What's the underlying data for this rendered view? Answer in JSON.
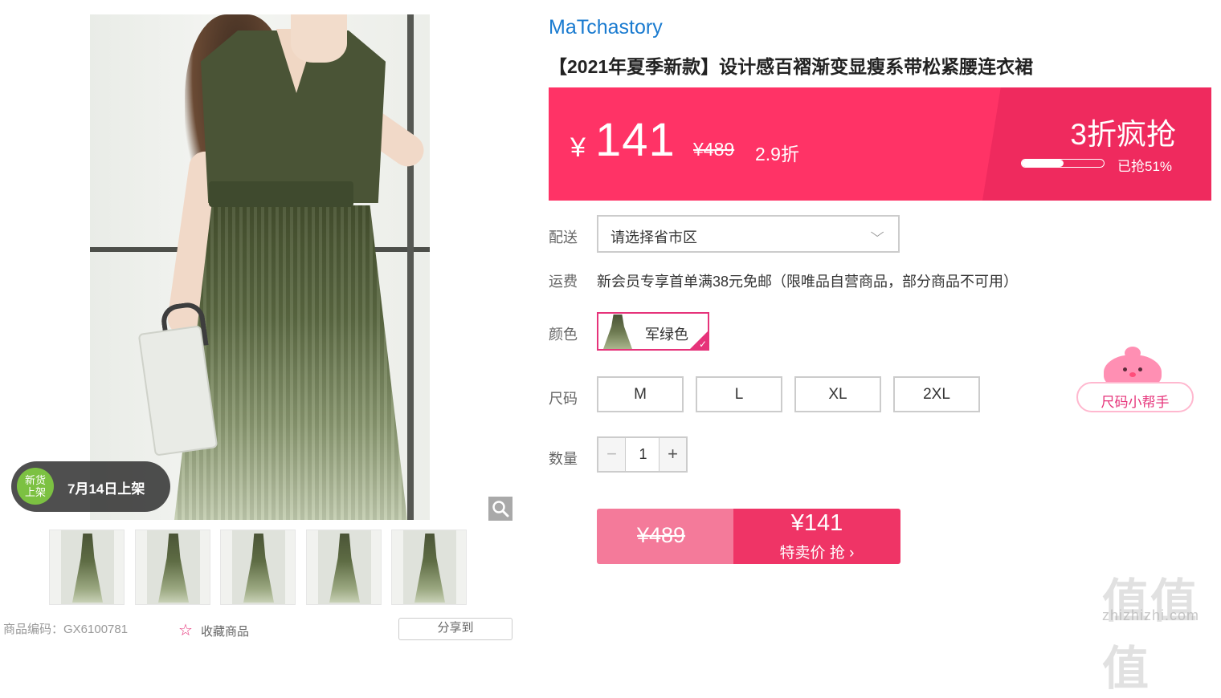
{
  "gallery": {
    "new_badge_top": "新货",
    "new_badge_bottom": "上架",
    "new_badge_text": "7月14日上架",
    "thumbnail_count": 5
  },
  "meta": {
    "product_code": "商品编码：GX6100781",
    "favorite_label": "收藏商品",
    "share_label": "分享到"
  },
  "product": {
    "brand": "MaTchastory",
    "title": "【2021年夏季新款】设计感百褶渐变显瘦系带松紧腰连衣裙"
  },
  "price_banner": {
    "currency": "¥",
    "price": "141",
    "original_price": "¥489",
    "discount": "2.9折",
    "promo_title": "3折疯抢",
    "sold_fraction": 0.51,
    "sold_label": "已抢51%",
    "color_primary": "#ff3366",
    "color_secondary": "#ef2a5e"
  },
  "options": {
    "delivery_label": "配送",
    "delivery_value": "请选择省市区",
    "shipping_label": "运费",
    "shipping_text": "新会员专享首单满38元免邮（限唯品自营商品，部分商品不可用）",
    "color_label": "颜色",
    "color_value": "军绿色",
    "size_label": "尺码",
    "sizes": [
      "M",
      "L",
      "XL",
      "2XL"
    ],
    "qty_label": "数量",
    "qty_minus": "−",
    "qty_value": "1",
    "qty_plus": "+"
  },
  "buy": {
    "original_price": "¥489",
    "price": "¥141",
    "label": "特卖价 抢 ›"
  },
  "size_helper": {
    "label": "尺码小帮手"
  },
  "watermark": {
    "text": "值值值",
    "url": "zhizhizhi.com"
  },
  "icons": {
    "zoom": "magnifier-icon",
    "chevron": "chevron-down-icon",
    "check": "check-icon",
    "star": "star-icon",
    "share": "share-icon"
  }
}
